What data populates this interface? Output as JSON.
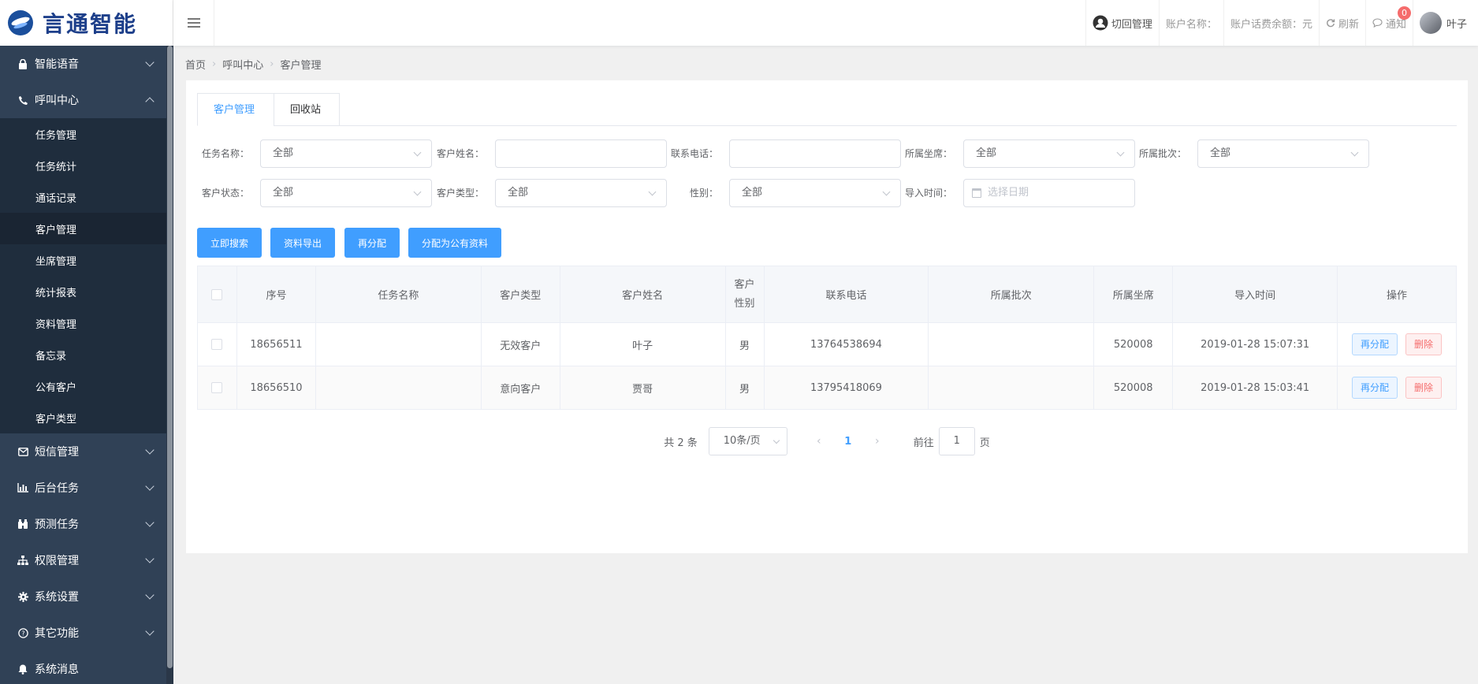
{
  "brand": {
    "name": "言通智能"
  },
  "header": {
    "switch_label": "切回管理",
    "account_name_label": "账户名称：",
    "balance_label": "账户话费余额：元",
    "refresh_label": "刷新",
    "notice_label": "通知",
    "notice_count": "0",
    "user_name": "叶子"
  },
  "sidebar": {
    "groups": [
      {
        "label": "智能语音",
        "icon": "lock-icon"
      },
      {
        "label": "呼叫中心",
        "icon": "phone-icon"
      },
      {
        "label": "短信管理",
        "icon": "mail-icon"
      },
      {
        "label": "后台任务",
        "icon": "bar-chart-icon"
      },
      {
        "label": "预测任务",
        "icon": "binoculars-icon"
      },
      {
        "label": "权限管理",
        "icon": "sitemap-icon"
      },
      {
        "label": "系统设置",
        "icon": "gear-icon"
      },
      {
        "label": "其它功能",
        "icon": "help-icon"
      },
      {
        "label": "系统消息",
        "icon": "bell-icon"
      }
    ],
    "callcenter_items": [
      "任务管理",
      "任务统计",
      "通话记录",
      "客户管理",
      "坐席管理",
      "统计报表",
      "资料管理",
      "备忘录",
      "公有客户",
      "客户类型"
    ]
  },
  "breadcrumb": [
    "首页",
    "呼叫中心",
    "客户管理"
  ],
  "tabs": [
    "客户管理",
    "回收站"
  ],
  "filters": {
    "task_name_label": "任务名称：",
    "task_name_value": "全部",
    "customer_name_label": "客户姓名：",
    "customer_name_value": "",
    "phone_label": "联系电话：",
    "phone_value": "",
    "agent_label": "所属坐席：",
    "agent_value": "全部",
    "batch_label": "所属批次：",
    "batch_value": "全部",
    "status_label": "客户状态：",
    "status_value": "全部",
    "type_label": "客户类型：",
    "type_value": "全部",
    "gender_label": "性别：",
    "gender_value": "全部",
    "import_time_label": "导入时间：",
    "import_time_placeholder": "选择日期"
  },
  "actions": [
    "立即搜索",
    "资料导出",
    "再分配",
    "分配为公有资料"
  ],
  "table": {
    "headers": [
      "序号",
      "任务名称",
      "客户类型",
      "客户姓名",
      "客户性别",
      "联系电话",
      "所属批次",
      "所属坐席",
      "导入时间",
      "操作"
    ],
    "rows": [
      {
        "id": "18656511",
        "task": "",
        "type": "无效客户",
        "name": "叶子",
        "gender": "男",
        "phone": "13764538694",
        "batch": "",
        "agent": "520008",
        "time": "2019-01-28 15:07:31"
      },
      {
        "id": "18656510",
        "task": "",
        "type": "意向客户",
        "name": "贾哥",
        "gender": "男",
        "phone": "13795418069",
        "batch": "",
        "agent": "520008",
        "time": "2019-01-28 15:03:41"
      }
    ],
    "row_actions": {
      "reassign": "再分配",
      "delete": "删除"
    }
  },
  "pagination": {
    "total": "共 2 条",
    "page_size": "10条/页",
    "current_page": "1",
    "goto_label": "前往",
    "goto_value": "1",
    "page_suffix": "页"
  }
}
